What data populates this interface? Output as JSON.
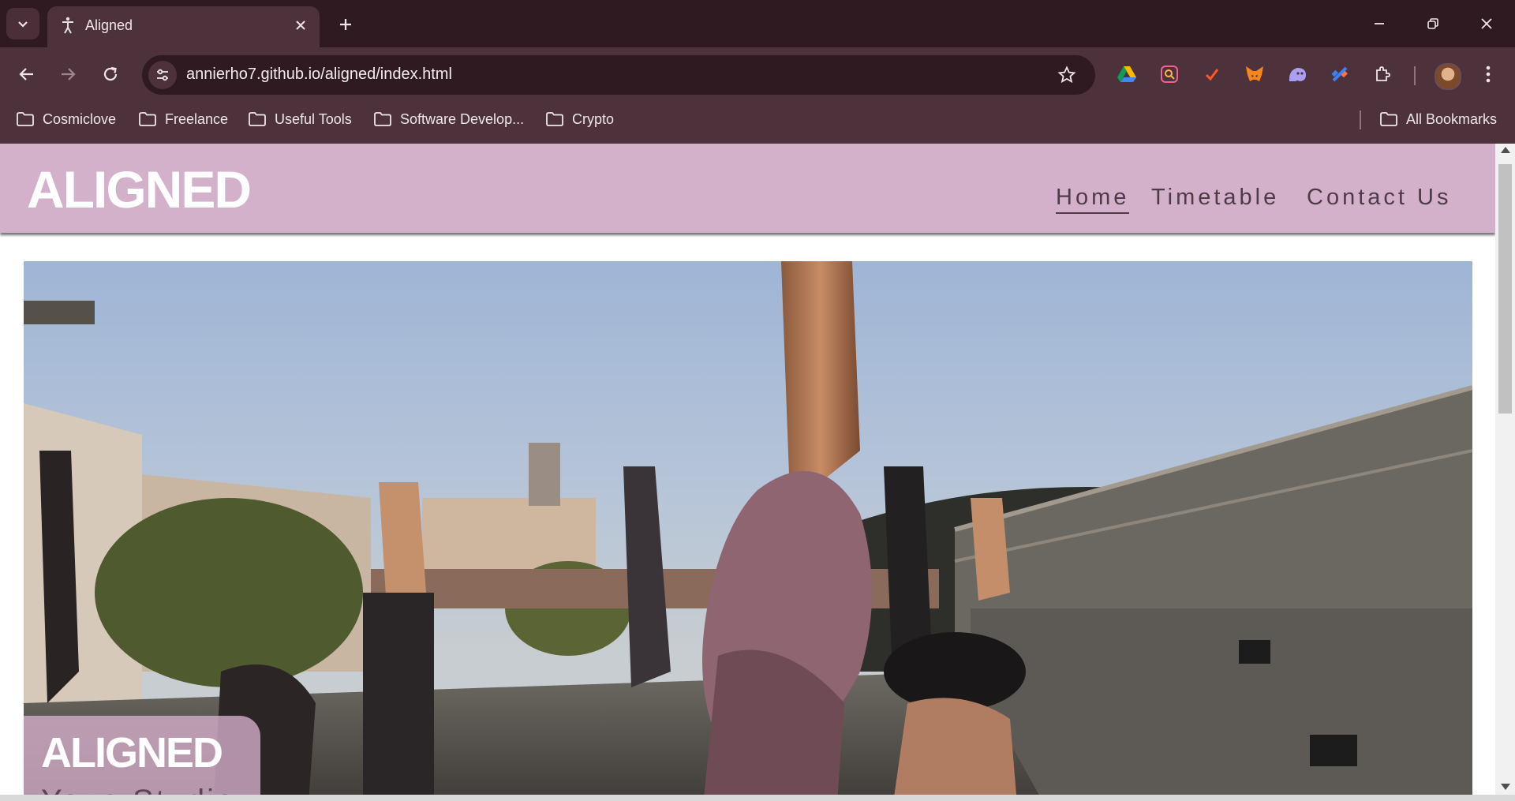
{
  "browser": {
    "tab": {
      "title": "Aligned",
      "close_symbol": "✕"
    },
    "new_tab_symbol": "+",
    "url": "annierho7.github.io/aligned/index.html",
    "bookmarks": [
      {
        "label": "Cosmiclove"
      },
      {
        "label": "Freelance"
      },
      {
        "label": "Useful Tools"
      },
      {
        "label": "Software Develop..."
      },
      {
        "label": "Crypto"
      }
    ],
    "all_bookmarks_label": "All Bookmarks",
    "extensions": [
      "google-drive-icon",
      "search-extension-icon",
      "brave-extension-icon",
      "metamask-fox-icon",
      "ghost-extension-icon",
      "satellite-extension-icon",
      "puzzle-extensions-icon"
    ]
  },
  "site": {
    "logo": "ALIGNED",
    "nav": [
      {
        "label": "Home",
        "active": true
      },
      {
        "label": "Timetable",
        "active": false
      },
      {
        "label": "Contact Us",
        "active": false
      }
    ],
    "hero": {
      "caption_title": "ALIGNED",
      "caption_subtitle": "Yoga Studio"
    }
  },
  "colors": {
    "header_bg": "#d3b1cb",
    "chrome_dark": "#2f1a22",
    "chrome_mid": "#4d323c",
    "nav_text": "#4f3a48"
  }
}
